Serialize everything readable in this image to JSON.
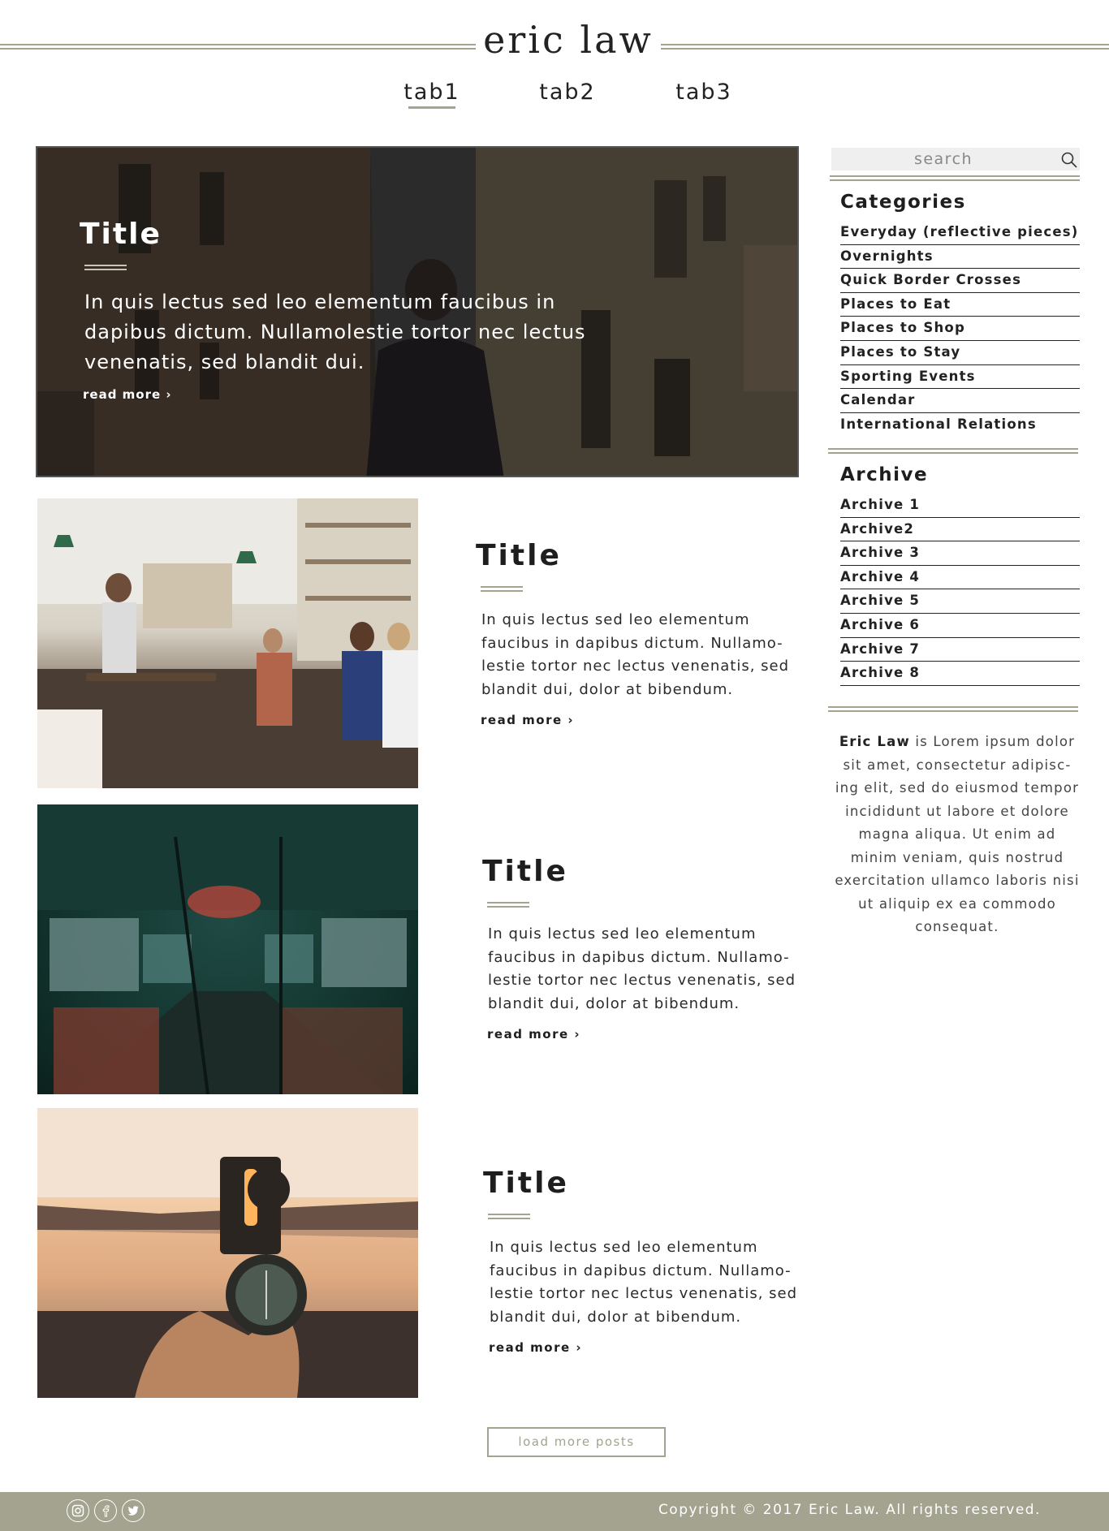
{
  "header": {
    "brand": "eric law",
    "tabs": [
      {
        "label": "tab1",
        "active": true
      },
      {
        "label": "tab2",
        "active": false
      },
      {
        "label": "tab3",
        "active": false
      }
    ]
  },
  "hero": {
    "title": "Title",
    "excerpt": "In quis lectus sed leo elementum faucibus in dapibus dictum. Nullamolestie tortor nec lectus venenatis, sed blandit dui.",
    "read_more": "read more ›"
  },
  "posts": [
    {
      "title": "Title",
      "excerpt": "In quis lectus sed leo elementum faucibus in dapibus dictum. Nullamo- lestie tortor nec lectus venenatis, sed blandit dui, dolor at bibendum.",
      "read_more": "read more ›",
      "image": "cafe-interior-photo"
    },
    {
      "title": "Title",
      "excerpt": "In quis lectus sed leo elementum faucibus in dapibus dictum. Nullamo- lestie tortor nec lectus venenatis, sed blandit dui, dolor at bibendum.",
      "read_more": "read more ›",
      "image": "bus-interior-photo"
    },
    {
      "title": "Title",
      "excerpt": "In quis lectus sed leo elementum faucibus in dapibus dictum. Nullamo- lestie tortor nec lectus venenatis, sed blandit dui, dolor at bibendum.",
      "read_more": "read more ›",
      "image": "compass-sunset-photo"
    }
  ],
  "load_more": "load more posts",
  "sidebar": {
    "search_placeholder": "search",
    "categories_heading": "Categories",
    "categories": [
      "Everyday (reflective pieces)",
      "Overnights",
      "Quick Border Crosses",
      "Places to Eat",
      "Places to Shop",
      "Places to Stay",
      "Sporting Events",
      "Calendar",
      "International Relations"
    ],
    "archive_heading": "Archive",
    "archive": [
      "Archive 1",
      "Archive2",
      "Archive 3",
      "Archive 4",
      "Archive 5",
      "Archive 6",
      "Archive 7",
      "Archive 8"
    ],
    "about_name": "Eric Law",
    "about_text": " is Lorem ipsum dolor sit amet, consectetur adipisc- ing elit, sed do eiusmod tempor incididunt ut labore et dolore magna aliqua. Ut enim ad minim veniam, quis nostrud exercitation ullamco laboris nisi ut aliquip ex ea commodo consequat."
  },
  "footer": {
    "social_icons": [
      "instagram-icon",
      "facebook-icon",
      "twitter-icon"
    ],
    "copyright": "Copyright © 2017 Eric Law. All rights reserved."
  },
  "colors": {
    "accent": "#a3a38f",
    "text": "#1e1e1e",
    "search_bg": "#efefef"
  }
}
